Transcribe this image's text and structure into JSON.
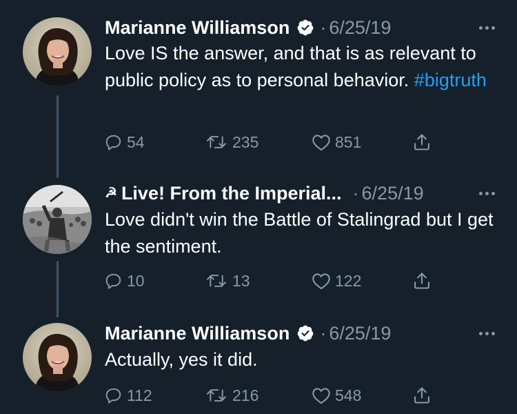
{
  "tweets": [
    {
      "author": "Marianne Williamson",
      "verified": true,
      "date_prefix": "·",
      "date": "6/25/19",
      "text": "Love IS the answer, and that is as relevant to public policy as to personal behavior.",
      "hashtag": "#bigtruth",
      "replies": "54",
      "retweets": "235",
      "likes": "851"
    },
    {
      "author_prefix": "☭",
      "author": "Live! From the Imperial...",
      "verified": false,
      "date_prefix": "·",
      "date": "6/25/19",
      "text": "Love didn't win the Battle of Stalingrad but I get the sentiment.",
      "replies": "10",
      "retweets": "13",
      "likes": "122"
    },
    {
      "author": "Marianne Williamson",
      "verified": true,
      "date_prefix": "·",
      "date": "6/25/19",
      "text": "Actually, yes it did.",
      "replies": "112",
      "retweets": "216",
      "likes": "548"
    }
  ],
  "colors": {
    "background": "#15202b",
    "secondary_text": "#8899a6",
    "link": "#1da1f2",
    "thread_line": "#3d5466"
  },
  "icons": [
    "verified-badge-icon",
    "more-icon",
    "reply-icon",
    "retweet-icon",
    "like-icon",
    "share-icon"
  ]
}
